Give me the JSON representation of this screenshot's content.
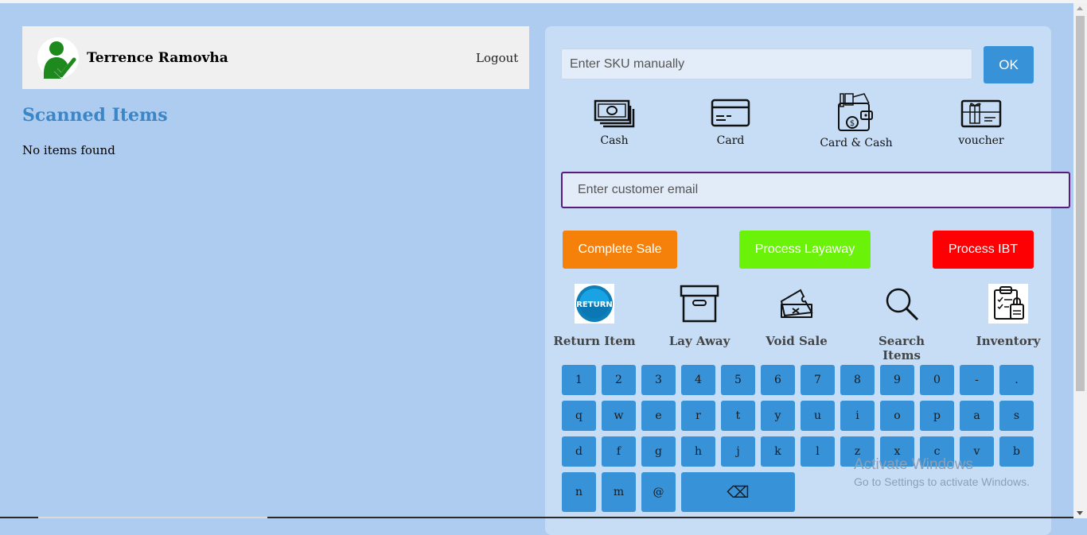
{
  "user": {
    "name": "Terrence Ramovha",
    "logout_label": "Logout"
  },
  "scanned": {
    "title": "Scanned Items",
    "empty_text": "No items found"
  },
  "sku": {
    "placeholder": "Enter SKU manually",
    "ok_label": "OK"
  },
  "payment_methods": [
    {
      "label": "Cash",
      "icon": "cash-icon"
    },
    {
      "label": "Card",
      "icon": "card-icon"
    },
    {
      "label": "Card & Cash",
      "icon": "wallet-icon"
    },
    {
      "label": "voucher",
      "icon": "voucher-icon"
    }
  ],
  "email": {
    "placeholder": "Enter customer email"
  },
  "actions": {
    "complete": "Complete Sale",
    "layaway": "Process Layaway",
    "ibt": "Process IBT"
  },
  "tools": [
    {
      "label": "Return Item",
      "icon": "return-icon",
      "badge": "RETURN"
    },
    {
      "label": "Lay Away",
      "icon": "archive-box-icon"
    },
    {
      "label": "Void Sale",
      "icon": "void-ticket-icon"
    },
    {
      "label": "Search Items",
      "icon": "search-icon"
    },
    {
      "label": "Inventory",
      "icon": "clipboard-icon"
    }
  ],
  "keyboard": {
    "row1": [
      "1",
      "2",
      "3",
      "4",
      "5",
      "6",
      "7",
      "8",
      "9",
      "0",
      "-",
      "."
    ],
    "row2": [
      "q",
      "w",
      "e",
      "r",
      "t",
      "y",
      "u",
      "i",
      "o",
      "p",
      "a",
      "s"
    ],
    "row3": [
      "d",
      "f",
      "g",
      "h",
      "j",
      "k",
      "l",
      "z",
      "x",
      "c",
      "v",
      "b"
    ],
    "row4": [
      "n",
      "m",
      "@"
    ],
    "backspace": "⌫"
  },
  "watermark": {
    "line1": "Activate Windows",
    "line2": "Go to Settings to activate Windows."
  },
  "colors": {
    "background": "#aecbf0",
    "panel": "#c6ddf5",
    "accent_blue": "#3792d8",
    "complete_orange": "#f5810b",
    "layaway_green": "#6af209",
    "ibt_red": "#fd0004",
    "title_blue": "#3a86c6"
  }
}
